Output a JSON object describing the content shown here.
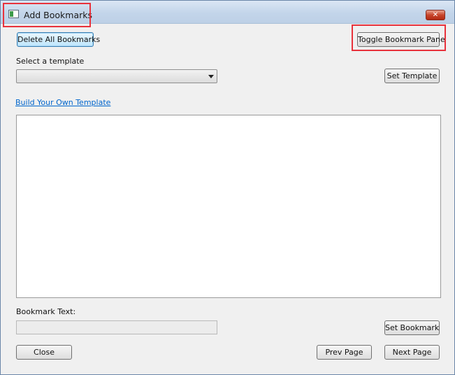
{
  "window": {
    "title": "Add Bookmarks",
    "close_glyph": "✕"
  },
  "toolbar": {
    "delete_all_label": "Delete All Bookmarks",
    "toggle_pane_label": "Toggle Bookmark Pane"
  },
  "template": {
    "select_label": "Select a template",
    "selected_value": "",
    "set_label": "Set Template",
    "build_link": "Build Your Own Template"
  },
  "bookmark": {
    "text_label": "Bookmark Text:",
    "text_value": "",
    "set_label": "Set Bookmark"
  },
  "footer": {
    "close_label": "Close",
    "prev_label": "Prev Page",
    "next_label": "Next Page"
  },
  "colors": {
    "highlight": "#e8323c",
    "link": "#0066cc"
  }
}
